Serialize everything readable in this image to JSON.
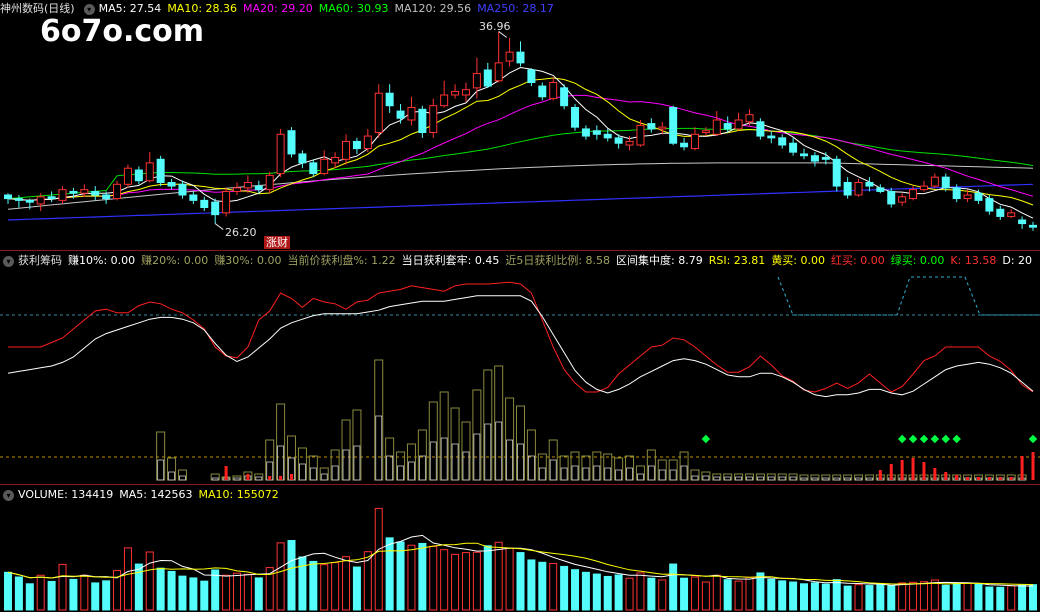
{
  "watermark": "6o7o.com",
  "price_panel": {
    "title": "神州数码(日线)",
    "indicators": [
      {
        "label": "MA5: 27.54",
        "color": "#ffffff"
      },
      {
        "label": "MA10: 28.36",
        "color": "#ffff00"
      },
      {
        "label": "MA20: 29.20",
        "color": "#ff00ff"
      },
      {
        "label": "MA60: 30.93",
        "color": "#00ff00"
      },
      {
        "label": "MA120: 29.56",
        "color": "#c0c0c0"
      },
      {
        "label": "MA250: 28.17",
        "color": "#4040ff"
      }
    ],
    "high_label": "36.96",
    "low_label": "26.20",
    "tag": "涨财"
  },
  "chip_panel": {
    "title": "获利筹码",
    "indicators": [
      {
        "label": "赚10%: 0.00",
        "color": "#ffffff"
      },
      {
        "label": "赚20%: 0.00",
        "color": "#a0a060"
      },
      {
        "label": "赚30%: 0.00",
        "color": "#a0a060"
      },
      {
        "label": "当前价获利盘%: 1.22",
        "color": "#a0a060"
      },
      {
        "label": "当日获利套牢: 0.45",
        "color": "#ffffff"
      },
      {
        "label": "近5日获利比例: 8.58",
        "color": "#a0a060"
      },
      {
        "label": "区间集中度: 8.79",
        "color": "#ffffff"
      },
      {
        "label": "RSI: 23.81",
        "color": "#ffff00"
      },
      {
        "label": "黄买: 0.00",
        "color": "#ffff00"
      },
      {
        "label": "红买: 0.00",
        "color": "#ff3030"
      },
      {
        "label": "绿买: 0.00",
        "color": "#00ff00"
      },
      {
        "label": "K: 13.58",
        "color": "#ff3030"
      },
      {
        "label": "D: 20",
        "color": "#ffffff"
      }
    ]
  },
  "volume_panel": {
    "indicators": [
      {
        "label": "VOLUME: 134419",
        "color": "#ffffff"
      },
      {
        "label": "MA5: 142563",
        "color": "#ffffff"
      },
      {
        "label": "MA10: 155072",
        "color": "#ffff00"
      }
    ]
  },
  "colors": {
    "up": "#ff3232",
    "down": "#54fcfc",
    "bg": "#000000"
  },
  "candles": [
    {
      "o": 27.8,
      "c": 27.6,
      "h": 27.9,
      "l": 27.3
    },
    {
      "o": 27.6,
      "c": 27.5,
      "h": 27.8,
      "l": 27.1
    },
    {
      "o": 27.5,
      "c": 27.4,
      "h": 27.6,
      "l": 27.0
    },
    {
      "o": 27.3,
      "c": 27.7,
      "h": 27.9,
      "l": 26.9
    },
    {
      "o": 27.7,
      "c": 27.6,
      "h": 28.0,
      "l": 27.4
    },
    {
      "o": 27.5,
      "c": 28.1,
      "h": 28.3,
      "l": 27.3
    },
    {
      "o": 28.0,
      "c": 27.9,
      "h": 28.2,
      "l": 27.6
    },
    {
      "o": 27.9,
      "c": 28.1,
      "h": 28.4,
      "l": 27.7
    },
    {
      "o": 28.0,
      "c": 27.8,
      "h": 28.3,
      "l": 27.5
    },
    {
      "o": 27.8,
      "c": 27.6,
      "h": 28.0,
      "l": 27.3
    },
    {
      "o": 27.6,
      "c": 28.4,
      "h": 28.6,
      "l": 27.5
    },
    {
      "o": 28.4,
      "c": 29.3,
      "h": 29.5,
      "l": 28.2
    },
    {
      "o": 29.2,
      "c": 28.6,
      "h": 29.4,
      "l": 28.4
    },
    {
      "o": 28.6,
      "c": 29.6,
      "h": 30.2,
      "l": 28.5
    },
    {
      "o": 29.8,
      "c": 28.5,
      "h": 30.0,
      "l": 28.3
    },
    {
      "o": 28.5,
      "c": 28.3,
      "h": 28.7,
      "l": 28.1
    },
    {
      "o": 28.4,
      "c": 27.8,
      "h": 28.6,
      "l": 27.6
    },
    {
      "o": 27.8,
      "c": 27.5,
      "h": 28.0,
      "l": 27.3
    },
    {
      "o": 27.5,
      "c": 27.1,
      "h": 27.7,
      "l": 26.9
    },
    {
      "o": 27.4,
      "c": 26.7,
      "h": 27.6,
      "l": 26.2
    },
    {
      "o": 26.8,
      "c": 28.0,
      "h": 28.2,
      "l": 26.6
    },
    {
      "o": 28.0,
      "c": 28.2,
      "h": 28.5,
      "l": 27.8
    },
    {
      "o": 28.2,
      "c": 28.5,
      "h": 28.9,
      "l": 27.9
    },
    {
      "o": 28.3,
      "c": 28.1,
      "h": 28.6,
      "l": 27.9
    },
    {
      "o": 28.1,
      "c": 28.9,
      "h": 29.1,
      "l": 27.9
    },
    {
      "o": 29.0,
      "c": 31.2,
      "h": 31.5,
      "l": 28.8
    },
    {
      "o": 31.4,
      "c": 30.1,
      "h": 31.6,
      "l": 29.9
    },
    {
      "o": 30.1,
      "c": 29.6,
      "h": 30.3,
      "l": 29.3
    },
    {
      "o": 29.6,
      "c": 29.0,
      "h": 29.8,
      "l": 28.8
    },
    {
      "o": 29.0,
      "c": 29.8,
      "h": 30.3,
      "l": 28.9
    },
    {
      "o": 29.6,
      "c": 29.9,
      "h": 30.2,
      "l": 29.3
    },
    {
      "o": 29.8,
      "c": 30.8,
      "h": 31.2,
      "l": 29.5
    },
    {
      "o": 30.8,
      "c": 30.4,
      "h": 31.0,
      "l": 30.1
    },
    {
      "o": 30.4,
      "c": 31.1,
      "h": 31.5,
      "l": 30.2
    },
    {
      "o": 31.3,
      "c": 33.5,
      "h": 34.0,
      "l": 31.0
    },
    {
      "o": 33.5,
      "c": 32.8,
      "h": 34.0,
      "l": 32.4
    },
    {
      "o": 32.5,
      "c": 32.1,
      "h": 32.9,
      "l": 31.8
    },
    {
      "o": 32.0,
      "c": 32.7,
      "h": 33.3,
      "l": 31.7
    },
    {
      "o": 32.6,
      "c": 31.3,
      "h": 32.8,
      "l": 31.0
    },
    {
      "o": 31.3,
      "c": 32.8,
      "h": 33.2,
      "l": 31.0
    },
    {
      "o": 32.8,
      "c": 33.4,
      "h": 34.2,
      "l": 32.7
    },
    {
      "o": 33.4,
      "c": 33.6,
      "h": 34.0,
      "l": 33.2
    },
    {
      "o": 33.4,
      "c": 33.7,
      "h": 34.1,
      "l": 33.0
    },
    {
      "o": 33.8,
      "c": 34.6,
      "h": 35.5,
      "l": 33.2
    },
    {
      "o": 34.8,
      "c": 33.9,
      "h": 35.2,
      "l": 33.8
    },
    {
      "o": 34.2,
      "c": 35.2,
      "h": 36.96,
      "l": 34.1
    },
    {
      "o": 35.3,
      "c": 35.8,
      "h": 36.6,
      "l": 35.0
    },
    {
      "o": 35.8,
      "c": 35.2,
      "h": 36.4,
      "l": 35.0
    },
    {
      "o": 34.8,
      "c": 34.1,
      "h": 34.9,
      "l": 33.9
    },
    {
      "o": 33.9,
      "c": 33.3,
      "h": 34.1,
      "l": 33.1
    },
    {
      "o": 33.2,
      "c": 34.1,
      "h": 34.4,
      "l": 33.1
    },
    {
      "o": 33.8,
      "c": 32.8,
      "h": 34.0,
      "l": 32.6
    },
    {
      "o": 32.7,
      "c": 31.6,
      "h": 32.9,
      "l": 31.4
    },
    {
      "o": 31.5,
      "c": 31.1,
      "h": 31.7,
      "l": 30.9
    },
    {
      "o": 31.4,
      "c": 31.2,
      "h": 31.7,
      "l": 30.9
    },
    {
      "o": 31.2,
      "c": 31.0,
      "h": 31.5,
      "l": 30.8
    },
    {
      "o": 31.0,
      "c": 30.7,
      "h": 31.2,
      "l": 30.4
    },
    {
      "o": 30.6,
      "c": 30.8,
      "h": 31.1,
      "l": 30.3
    },
    {
      "o": 30.6,
      "c": 31.7,
      "h": 32.0,
      "l": 30.5
    },
    {
      "o": 31.8,
      "c": 31.5,
      "h": 32.1,
      "l": 31.3
    },
    {
      "o": 31.5,
      "c": 31.6,
      "h": 31.9,
      "l": 31.2
    },
    {
      "o": 32.7,
      "c": 30.7,
      "h": 32.8,
      "l": 30.6
    },
    {
      "o": 30.7,
      "c": 30.5,
      "h": 31.0,
      "l": 30.3
    },
    {
      "o": 30.4,
      "c": 31.2,
      "h": 31.6,
      "l": 30.3
    },
    {
      "o": 31.3,
      "c": 31.4,
      "h": 31.6,
      "l": 31.1
    },
    {
      "o": 31.2,
      "c": 32.0,
      "h": 32.5,
      "l": 31.1
    },
    {
      "o": 31.8,
      "c": 31.5,
      "h": 32.2,
      "l": 31.3
    },
    {
      "o": 31.5,
      "c": 32.0,
      "h": 32.4,
      "l": 31.4
    },
    {
      "o": 31.9,
      "c": 32.3,
      "h": 32.6,
      "l": 31.7
    },
    {
      "o": 31.9,
      "c": 31.1,
      "h": 32.1,
      "l": 30.9
    },
    {
      "o": 31.1,
      "c": 31.0,
      "h": 31.4,
      "l": 30.7
    },
    {
      "o": 31.0,
      "c": 30.6,
      "h": 31.2,
      "l": 30.4
    },
    {
      "o": 30.7,
      "c": 30.2,
      "h": 31.0,
      "l": 30.0
    },
    {
      "o": 30.1,
      "c": 30.0,
      "h": 30.4,
      "l": 29.8
    },
    {
      "o": 30.0,
      "c": 29.7,
      "h": 30.2,
      "l": 29.4
    },
    {
      "o": 29.9,
      "c": 29.8,
      "h": 30.2,
      "l": 29.5
    },
    {
      "o": 29.8,
      "c": 28.3,
      "h": 30.0,
      "l": 28.0
    },
    {
      "o": 28.5,
      "c": 27.8,
      "h": 28.8,
      "l": 27.6
    },
    {
      "o": 27.8,
      "c": 28.5,
      "h": 28.7,
      "l": 27.7
    },
    {
      "o": 28.5,
      "c": 28.3,
      "h": 28.8,
      "l": 28.0
    },
    {
      "o": 28.2,
      "c": 28.0,
      "h": 28.4,
      "l": 27.9
    },
    {
      "o": 28.0,
      "c": 27.3,
      "h": 28.2,
      "l": 27.1
    },
    {
      "o": 27.4,
      "c": 27.7,
      "h": 27.9,
      "l": 27.2
    },
    {
      "o": 27.6,
      "c": 28.1,
      "h": 28.3,
      "l": 27.5
    },
    {
      "o": 28.1,
      "c": 28.3,
      "h": 28.6,
      "l": 28.0
    },
    {
      "o": 28.3,
      "c": 28.8,
      "h": 29.0,
      "l": 28.2
    },
    {
      "o": 28.8,
      "c": 28.2,
      "h": 29.0,
      "l": 28.0
    },
    {
      "o": 28.2,
      "c": 27.6,
      "h": 28.4,
      "l": 27.4
    },
    {
      "o": 27.6,
      "c": 27.8,
      "h": 28.1,
      "l": 27.4
    },
    {
      "o": 27.9,
      "c": 27.5,
      "h": 28.1,
      "l": 27.3
    },
    {
      "o": 27.6,
      "c": 26.9,
      "h": 27.8,
      "l": 26.7
    },
    {
      "o": 27.0,
      "c": 26.6,
      "h": 27.2,
      "l": 26.4
    },
    {
      "o": 26.6,
      "c": 26.8,
      "h": 27.0,
      "l": 26.5
    },
    {
      "o": 26.4,
      "c": 26.2,
      "h": 26.6,
      "l": 25.9
    },
    {
      "o": 26.1,
      "c": 26.0,
      "h": 26.3,
      "l": 25.8
    }
  ],
  "volumes": [
    128000,
    112000,
    89000,
    118000,
    97000,
    155000,
    104000,
    118000,
    92000,
    99000,
    134000,
    211000,
    156000,
    197000,
    142000,
    131000,
    115000,
    109000,
    98000,
    136000,
    118000,
    125000,
    121000,
    109000,
    144000,
    228000,
    236000,
    180000,
    165000,
    154000,
    161000,
    181000,
    146000,
    198000,
    345000,
    245000,
    231000,
    220000,
    226000,
    216000,
    205000,
    189000,
    195000,
    196000,
    218000,
    230000,
    210000,
    195000,
    170000,
    162000,
    158000,
    148000,
    137000,
    128000,
    122000,
    114000,
    119000,
    108000,
    126000,
    108000,
    102000,
    156000,
    108000,
    112000,
    95000,
    118000,
    103000,
    98000,
    111000,
    126000,
    104000,
    99000,
    95000,
    89000,
    92000,
    88000,
    103000,
    81000,
    86000,
    83000,
    88000,
    82000,
    92000,
    94000,
    96000,
    102000,
    84000,
    90000,
    91000,
    87000,
    78000,
    77000,
    82000,
    84000,
    86000
  ]
}
